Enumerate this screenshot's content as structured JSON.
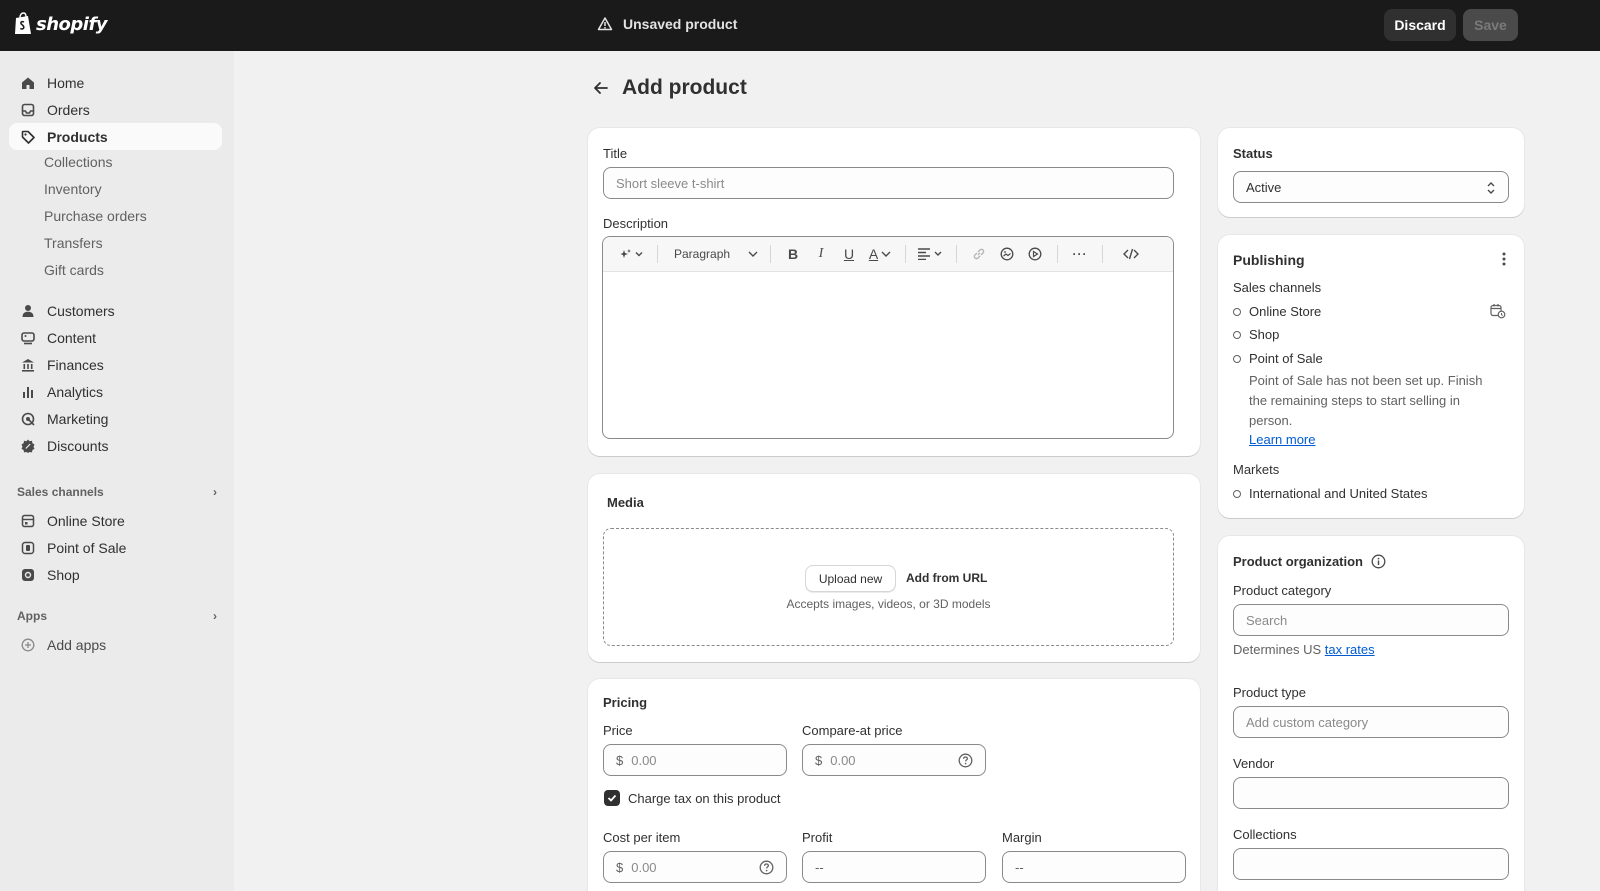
{
  "topbar": {
    "brand": "shopify",
    "unsaved": "Unsaved product",
    "discard": "Discard",
    "save": "Save"
  },
  "sidebar": {
    "items": [
      {
        "label": "Home",
        "icon": "home-icon"
      },
      {
        "label": "Orders",
        "icon": "inbox-icon"
      },
      {
        "label": "Products",
        "icon": "tag-icon"
      }
    ],
    "product_sub": [
      "Collections",
      "Inventory",
      "Purchase orders",
      "Transfers",
      "Gift cards"
    ],
    "items2": [
      {
        "label": "Customers",
        "icon": "person-icon"
      },
      {
        "label": "Content",
        "icon": "content-icon"
      },
      {
        "label": "Finances",
        "icon": "bank-icon"
      },
      {
        "label": "Analytics",
        "icon": "bar-chart-icon"
      },
      {
        "label": "Marketing",
        "icon": "target-icon"
      },
      {
        "label": "Discounts",
        "icon": "discount-icon"
      }
    ],
    "sales_channels_head": "Sales channels",
    "channels": [
      {
        "label": "Online Store",
        "icon": "store-icon"
      },
      {
        "label": "Point of Sale",
        "icon": "pos-icon"
      },
      {
        "label": "Shop",
        "icon": "shop-icon"
      }
    ],
    "apps_head": "Apps",
    "add_apps": "Add apps"
  },
  "main": {
    "title": "Add product",
    "title_label": "Title",
    "title_placeholder": "Short sleeve t-shirt",
    "description_label": "Description",
    "editor": {
      "paragraph": "Paragraph"
    },
    "media": {
      "title": "Media",
      "upload": "Upload new",
      "add_url": "Add from URL",
      "accepts": "Accepts images, videos, or 3D models"
    },
    "pricing": {
      "title": "Pricing",
      "price_label": "Price",
      "price_value": "0.00",
      "compare_label": "Compare-at price",
      "compare_value": "0.00",
      "currency": "$",
      "charge_tax": "Charge tax on this product",
      "cost_label": "Cost per item",
      "cost_value": "0.00",
      "profit_label": "Profit",
      "profit_value": "--",
      "margin_label": "Margin",
      "margin_value": "--"
    }
  },
  "right": {
    "status": {
      "label": "Status",
      "value": "Active"
    },
    "publishing": {
      "title": "Publishing",
      "sales_channels": "Sales channels",
      "channels": [
        "Online Store",
        "Shop",
        "Point of Sale"
      ],
      "pos_note": "Point of Sale has not been set up. Finish the remaining steps to start selling in person.",
      "learn_more": "Learn more",
      "markets_label": "Markets",
      "markets_value": "International and United States"
    },
    "organization": {
      "title": "Product organization",
      "category_label": "Product category",
      "category_placeholder": "Search",
      "determines": "Determines US",
      "tax_rates": "tax rates",
      "type_label": "Product type",
      "type_placeholder": "Add custom category",
      "vendor_label": "Vendor",
      "collections_label": "Collections"
    }
  }
}
